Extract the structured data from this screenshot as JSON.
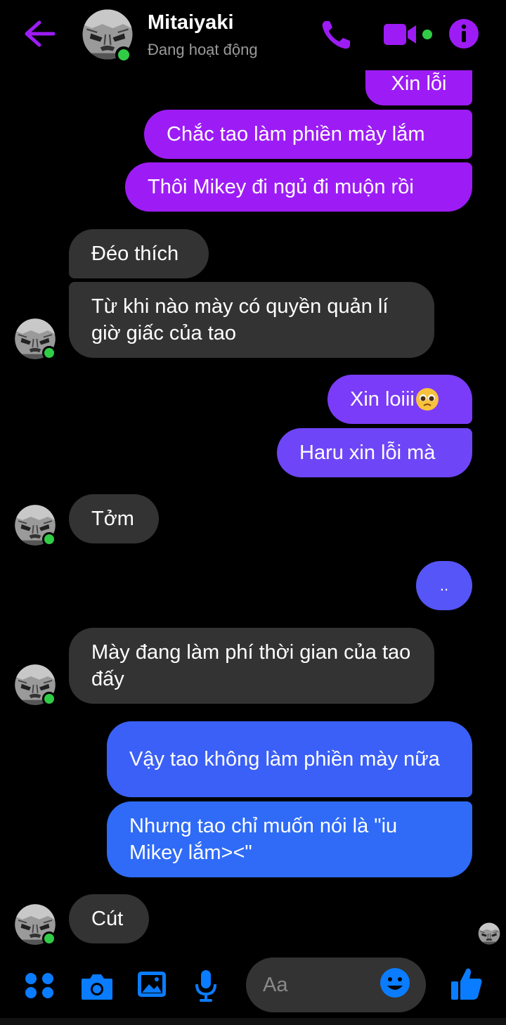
{
  "header": {
    "name": "Mitaiyaki",
    "status": "Đang hoạt động"
  },
  "messages": [
    {
      "side": "out",
      "text": "Xin lỗi"
    },
    {
      "side": "out",
      "text": "Chắc tao làm phiền mày lắm"
    },
    {
      "side": "out",
      "text": "Thôi Mikey đi ngủ đi muộn rồi"
    },
    {
      "side": "in",
      "text": "Đéo thích"
    },
    {
      "side": "in",
      "text": "Từ khi nào mày có quyền quản lí giờ giấc của tao"
    },
    {
      "side": "out",
      "text": "Xin loiii"
    },
    {
      "side": "out",
      "text": "Haru xin lỗi mà"
    },
    {
      "side": "in",
      "text": "Tởm"
    },
    {
      "side": "out",
      "text": ".."
    },
    {
      "side": "in",
      "text": "Mày đang làm phí thời gian của tao đấy"
    },
    {
      "side": "out",
      "text": "Vậy tao không làm phiền mày nữa"
    },
    {
      "side": "out",
      "text": "Nhưng tao chỉ muốn nói là \"iu Mikey lắm><\""
    },
    {
      "side": "in",
      "text": "Cút"
    }
  ],
  "composer": {
    "placeholder": "Aa"
  },
  "colors": {
    "accent": "#9d1cf5",
    "incoming": "#333333",
    "outgoing_blue": "#2f6bf7",
    "online": "#31cc46"
  },
  "icons": [
    "back-arrow-icon",
    "phone-icon",
    "video-camera-icon",
    "info-icon",
    "apps-icon",
    "camera-icon",
    "gallery-icon",
    "microphone-icon",
    "emoji-icon",
    "thumbs-up-icon",
    "pleading-face-emoji"
  ]
}
